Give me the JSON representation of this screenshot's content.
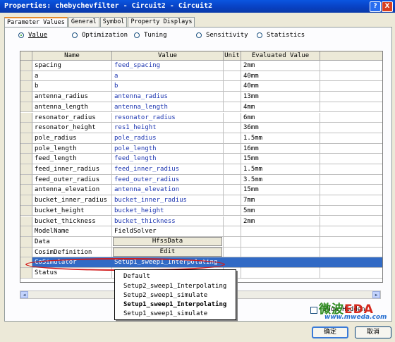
{
  "window": {
    "title": "Properties: chebychevfilter - Circuit2 - Circuit2",
    "help_label": "?",
    "close_label": "X"
  },
  "tabs": [
    "Parameter Values",
    "General",
    "Symbol",
    "Property Displays"
  ],
  "radios": [
    {
      "label": "Value",
      "checked": true
    },
    {
      "label": "Optimization",
      "checked": false
    },
    {
      "label": "Tuning",
      "checked": false
    },
    {
      "label": "Sensitivity",
      "checked": false
    },
    {
      "label": "Statistics",
      "checked": false
    }
  ],
  "grid": {
    "headers": [
      "Name",
      "Value",
      "Unit",
      "Evaluated Value"
    ],
    "rows": [
      {
        "name": "spacing",
        "value": "feed_spacing",
        "unit": "",
        "evaluated": "2mm"
      },
      {
        "name": "a",
        "value": "a",
        "unit": "",
        "evaluated": "40mm"
      },
      {
        "name": "b",
        "value": "b",
        "unit": "",
        "evaluated": "40mm"
      },
      {
        "name": "antenna_radius",
        "value": "antenna_radius",
        "unit": "",
        "evaluated": "13mm"
      },
      {
        "name": "antenna_length",
        "value": "antenna_length",
        "unit": "",
        "evaluated": "4mm"
      },
      {
        "name": "resonator_radius",
        "value": "resonator_radius",
        "unit": "",
        "evaluated": "6mm"
      },
      {
        "name": "resonator_height",
        "value": "res1_height",
        "unit": "",
        "evaluated": "36mm"
      },
      {
        "name": "pole_radius",
        "value": "pole_radius",
        "unit": "",
        "evaluated": "1.5mm"
      },
      {
        "name": "pole_length",
        "value": "pole_length",
        "unit": "",
        "evaluated": "16mm"
      },
      {
        "name": "feed_length",
        "value": "feed_length",
        "unit": "",
        "evaluated": "15mm"
      },
      {
        "name": "feed_inner_radius",
        "value": "feed_inner_radius",
        "unit": "",
        "evaluated": "1.5mm"
      },
      {
        "name": "feed_outer_radius",
        "value": "feed_outer_radius",
        "unit": "",
        "evaluated": "3.5mm"
      },
      {
        "name": "antenna_elevation",
        "value": "antenna_elevation",
        "unit": "",
        "evaluated": "15mm"
      },
      {
        "name": "bucket_inner_radius",
        "value": "bucket_inner_radius",
        "unit": "",
        "evaluated": "7mm"
      },
      {
        "name": "bucket_height",
        "value": "bucket_height",
        "unit": "",
        "evaluated": "5mm"
      },
      {
        "name": "bucket_thickness",
        "value": "bucket_thickness",
        "unit": "",
        "evaluated": "2mm"
      },
      {
        "name": "ModelName",
        "value": "FieldSolver",
        "unit": "",
        "evaluated": ""
      }
    ],
    "data_row": {
      "name": "Data",
      "button": "HfssData"
    },
    "cosim_row": {
      "name": "CosimDefinition",
      "button": "Edit"
    },
    "cosimulator_row": {
      "name": "CoSimulator",
      "value": "Setup1_sweep1_Interpolating"
    },
    "status_row": {
      "name": "Status"
    }
  },
  "dropdown": {
    "options": [
      "Default",
      "Setup2_sweep1_Interpolating",
      "Setup2_sweep1_simulate",
      "Setup1_sweep1_Interpolating",
      "Setup1_sweep1_simulate"
    ],
    "selected_index": 3
  },
  "scroll_arrows": {
    "left": "◀",
    "right": "▶"
  },
  "show_hidden": {
    "label": "Show Hidden",
    "checked": false
  },
  "watermark": {
    "text_a": "微波",
    "text_b": "EDA",
    "url": "www.mweda.com"
  },
  "buttons": {
    "ok": "确定",
    "cancel": "取消"
  },
  "colors": {
    "selection": "#316ac5",
    "highlight_ring": "#d21c1c",
    "value_text": "#1c35b0"
  }
}
